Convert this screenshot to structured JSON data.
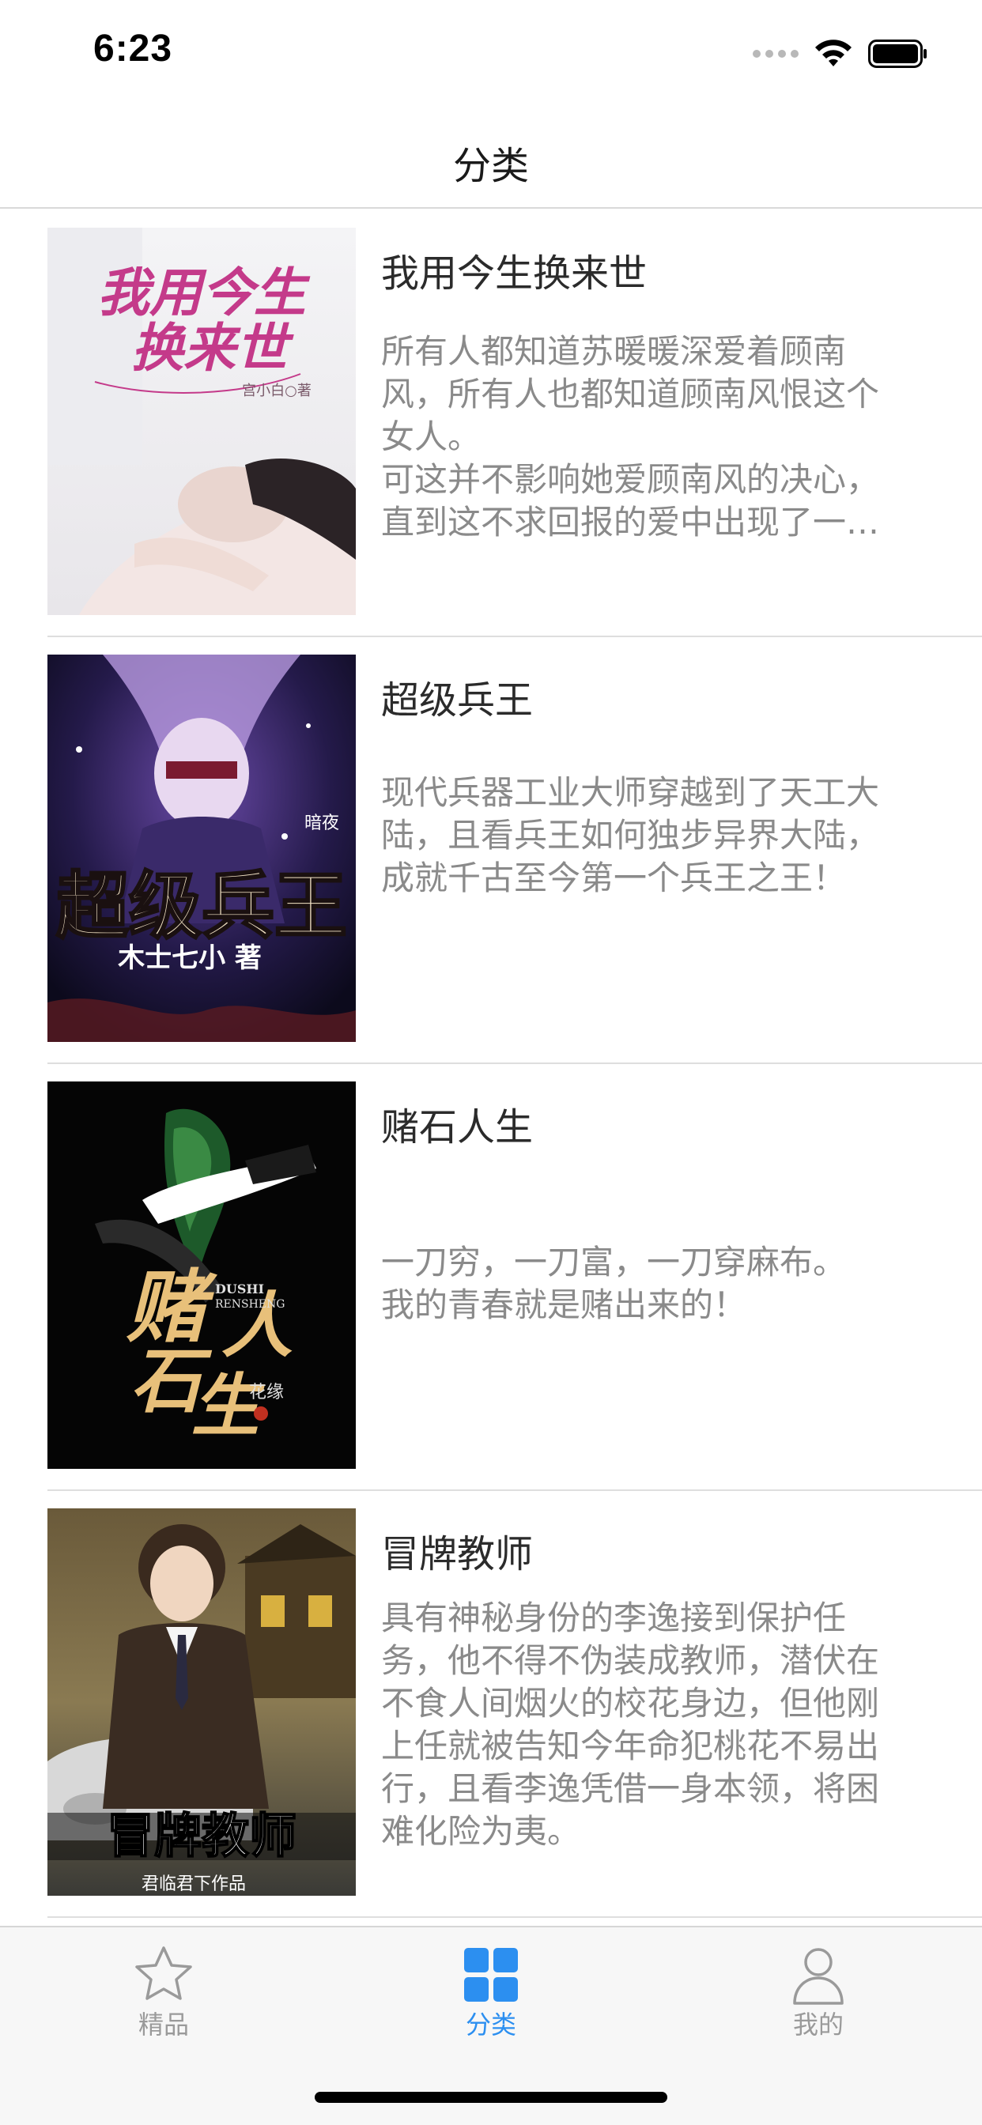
{
  "status_bar": {
    "time": "6:23"
  },
  "nav": {
    "title": "分类"
  },
  "books": [
    {
      "title": "我用今生换来世",
      "description": "所有人都知道苏暖暖深爱着顾南风，所有人也都知道顾南风恨这个女人。\n可这并不影响她爱顾南风的决心，直到这不求回报的爱中出现了一点私心，却将她推入了万劫不复的深渊。",
      "cover": {
        "title_line1": "我用今生",
        "title_line2": "换来世",
        "author": "宫小白○著"
      }
    },
    {
      "title": "超级兵王",
      "description": "现代兵器工业大师穿越到了天工大陆，且看兵王如何独步异界大陆，成就千古至今第一个兵王之王！",
      "cover": {
        "title": "超级兵王",
        "author": "木士七小 著",
        "badge": "暗夜"
      }
    },
    {
      "title": "赌石人生",
      "description": "一刀穷，一刀富，一刀穿麻布。\n我的青春就是赌出来的！",
      "cover": {
        "title_part1": "赌",
        "title_part2": "人",
        "title_part3": "石",
        "title_part4": "生",
        "latin1": "DUSHI",
        "latin2": "RENSHENG",
        "author": "花缘"
      }
    },
    {
      "title": "冒牌教师",
      "description": "具有神秘身份的李逸接到保护任务，他不得不伪装成教师，潜伏在不食人间烟火的校花身边，但他刚上任就被告知今年命犯桃花不易出行，且看李逸凭借一身本领，将困难化险为夷。",
      "cover": {
        "title": "冒牌教师",
        "author": "君临君下作品"
      }
    }
  ],
  "tabs": [
    {
      "label": "精品",
      "icon": "star-icon",
      "active": false
    },
    {
      "label": "分类",
      "icon": "grid-icon",
      "active": true
    },
    {
      "label": "我的",
      "icon": "person-icon",
      "active": false
    }
  ],
  "colors": {
    "accent": "#2c8ff0",
    "inactive": "#9a9a9a",
    "desc": "#8a8a8a"
  }
}
